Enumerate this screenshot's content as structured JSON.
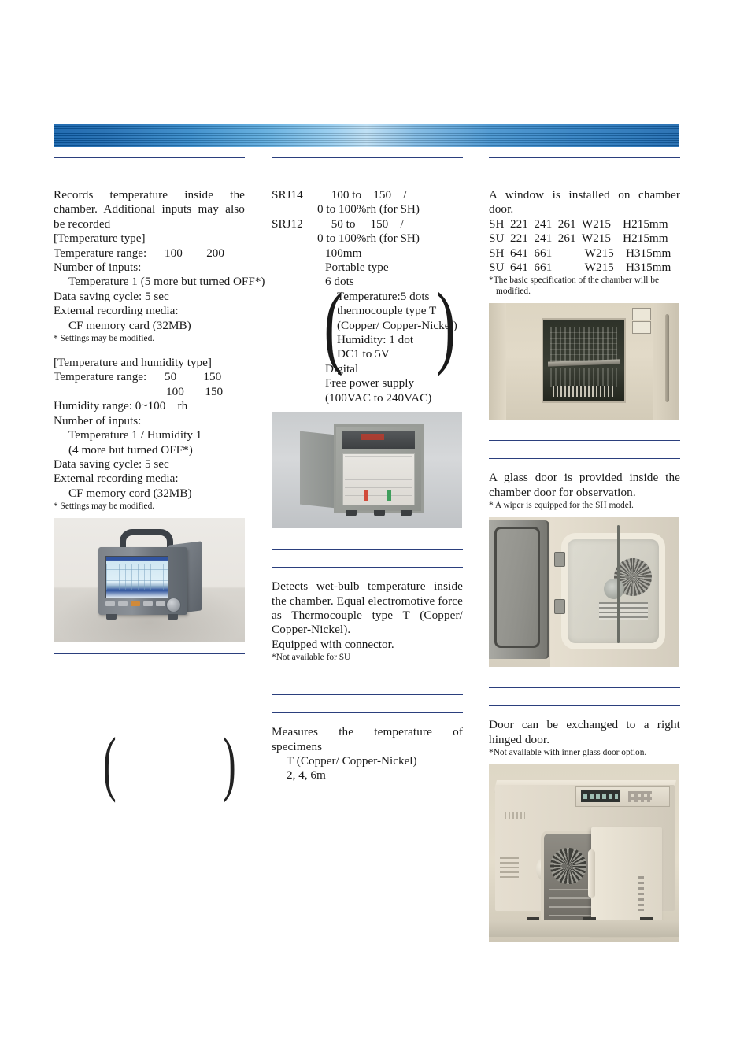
{
  "theme": {
    "rule_color": "#2b3f7d",
    "header_gradient_from": "#0a5ca8",
    "header_gradient_mid": "#b9ddf4",
    "header_gradient_to": "#1663ab"
  },
  "header": {
    "banner_label": ""
  },
  "columns": {
    "left": {
      "section_recorder": {
        "paragraph": "Records temperature inside the chamber. Additional inputs may also be recorded",
        "subhead_temp_type": "[Temperature type]",
        "temp_range": "Temperature range:      100        200",
        "inputs_label": "Number of inputs:",
        "inputs_value": "Temperature 1 (5 more but turned OFF*)",
        "saving_cycle": "Data saving cycle: 5 sec",
        "media_label": "External recording media:",
        "media_value": "CF memory card (32MB)",
        "footnote": "* Settings may be modified.",
        "subhead_temp_hum_type": "[Temperature and humidity type]",
        "th_temp_range_1": "Temperature range:      50         150",
        "th_temp_range_2": "100       150",
        "humidity_range": "Humidity range: 0~100    rh",
        "th_inputs_label": "Number of inputs:",
        "th_inputs_value_1": "Temperature 1 / Humidity 1",
        "th_inputs_value_2": "(4 more but turned OFF*)",
        "th_saving_cycle": "Data saving cycle: 5 sec",
        "th_media_label": "External recording media:",
        "th_media_value": "CF memory cord (32MB)",
        "th_footnote": "* Settings may be modified.",
        "photo_caption": "portable-data-recorder-photo"
      },
      "bottom_paren": {
        "left": "(",
        "right": ")",
        "content": ""
      }
    },
    "middle": {
      "section_models": {
        "model_1_name": "SRJ14",
        "model_1_range": "100 to    150    /",
        "model_1_range2": "0 to 100%rh (for SH)",
        "model_2_name": "SRJ12",
        "model_2_range": "50 to     150    /",
        "model_2_range2": "0 to 100%rh (for SH)",
        "chart_width": "100mm",
        "type": "Portable type",
        "dots": "6 dots",
        "bracket_left": "(",
        "bracket_right": ")",
        "bracket_lines": [
          "Temperature:5 dots",
          "thermocouple type T",
          "(Copper/ Copper-Nickel)",
          "Humidity: 1 dot",
          "DC1 to 5V"
        ],
        "digital": "Digital",
        "power_1": "Free power supply",
        "power_2": "(100VAC to 240VAC)",
        "photo_caption": "chart-recorder-photo"
      },
      "section_wetbulb": {
        "paragraph": "Detects wet-bulb temperature inside the chamber. Equal electromotive force as Thermocouple type T (Copper/ Copper-Nickel).",
        "line_connector": "Equipped with connector.",
        "footnote": "*Not available for SU"
      },
      "section_specimen": {
        "paragraph": "Measures the temperature of specimens",
        "detail_1": "T (Copper/ Copper-Nickel)",
        "detail_2": "2, 4, 6m"
      }
    },
    "right": {
      "section_window": {
        "paragraph": "A window is installed on chamber door.",
        "dimension_rows": [
          "SH  221  241  261  W215    H215mm",
          "SU  221  241  261  W215    H215mm",
          "SH  641  661           W215    H315mm",
          "SU  641  661           W215    H315mm"
        ],
        "footnote_1": "*The basic specification of the chamber will be",
        "footnote_2": "modified.",
        "photo_caption": "chamber-door-window-photo"
      },
      "section_glassdoor": {
        "paragraph": "A glass door is provided inside the chamber door for observation.",
        "footnote": "* A wiper is equipped for the SH model.",
        "photo_caption": "inner-glass-door-photo"
      },
      "section_righthinge": {
        "paragraph": "Door can be exchanged to a right hinged door.",
        "footnote": "*Not available with inner glass door option.",
        "photo_caption": "right-hinged-chamber-photo"
      }
    }
  }
}
